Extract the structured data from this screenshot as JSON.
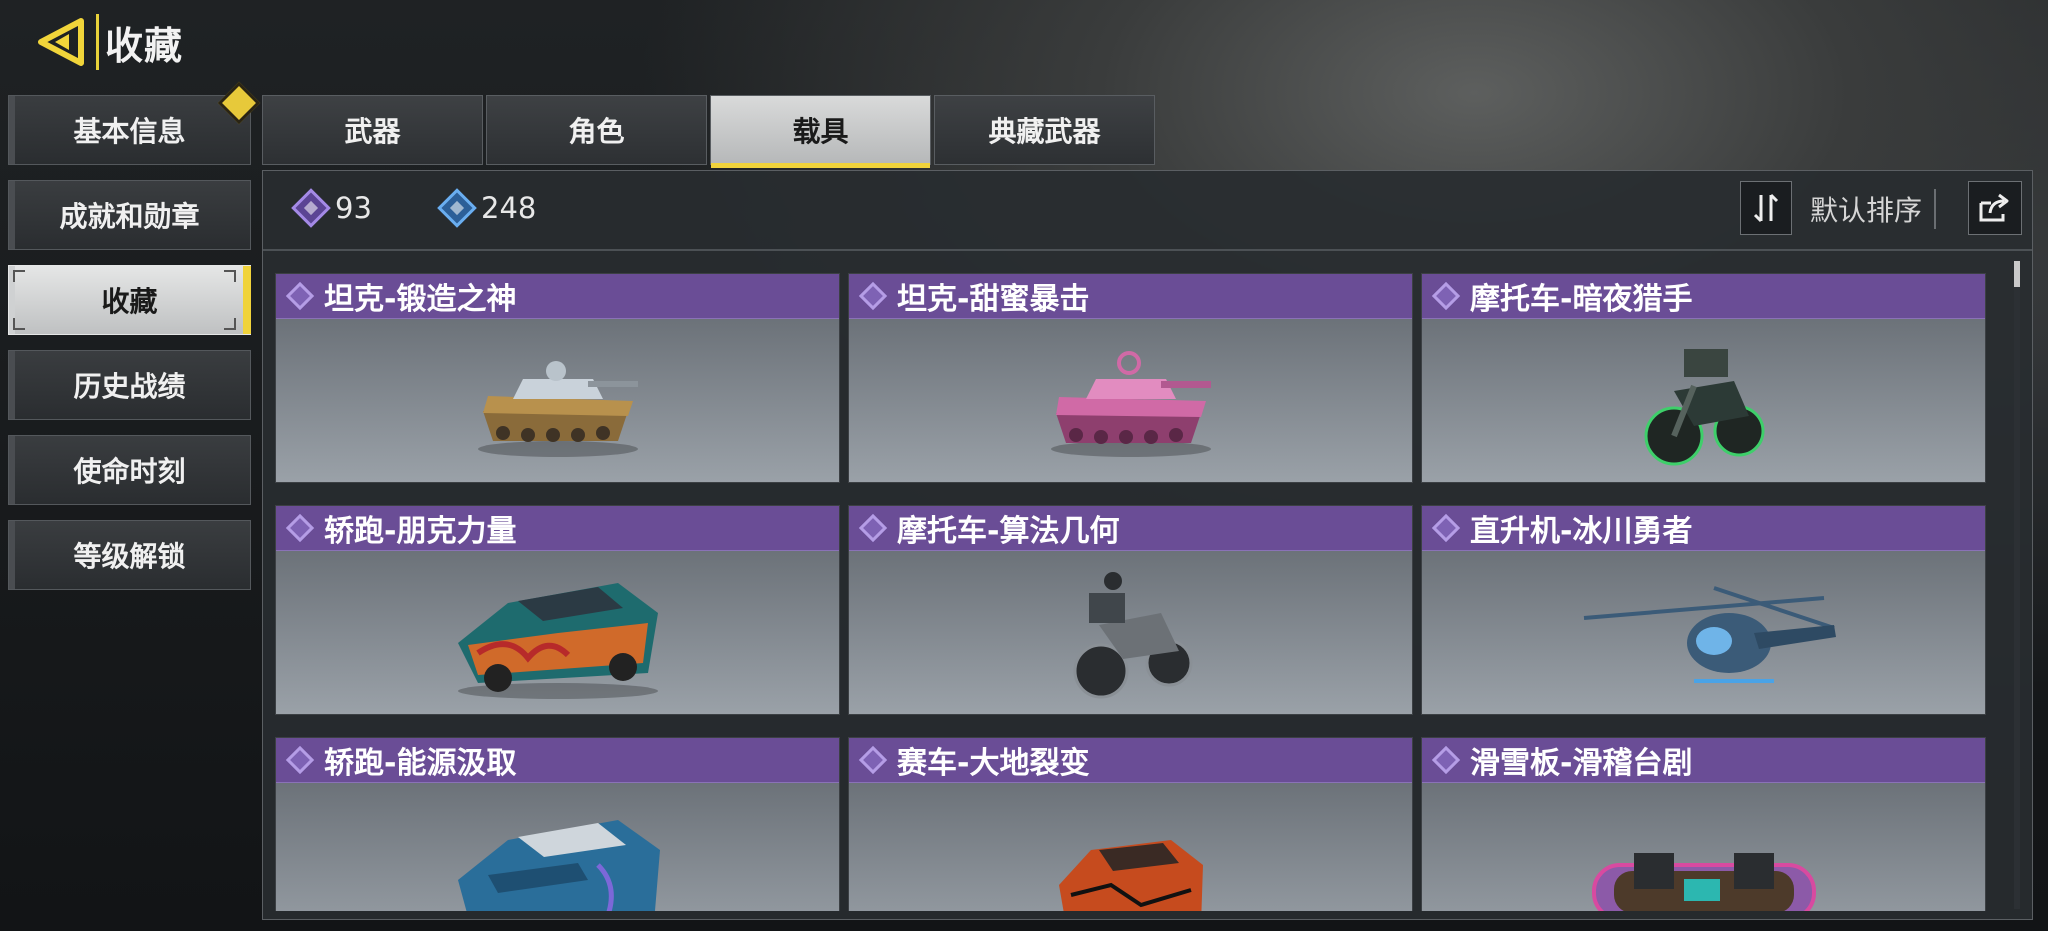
{
  "header": {
    "title": "收藏"
  },
  "sidebar": {
    "items": [
      {
        "label": "基本信息",
        "badge": true
      },
      {
        "label": "成就和勋章"
      },
      {
        "label": "收藏",
        "active": true
      },
      {
        "label": "历史战绩"
      },
      {
        "label": "使命时刻"
      },
      {
        "label": "等级解锁"
      }
    ]
  },
  "tabs": [
    {
      "label": "武器"
    },
    {
      "label": "角色"
    },
    {
      "label": "载具",
      "active": true
    },
    {
      "label": "典藏武器"
    }
  ],
  "toolbar": {
    "currency_purple": "93",
    "currency_blue": "248",
    "sort_label": "默认排序"
  },
  "cards": [
    {
      "name": "坦克-锻造之神",
      "icon": "tank-gold",
      "color": "#b8914d"
    },
    {
      "name": "坦克-甜蜜暴击",
      "icon": "tank-pink",
      "color": "#d06aa6"
    },
    {
      "name": "摩托车-暗夜猎手",
      "icon": "motorcycle-dark",
      "color": "#2c3a36"
    },
    {
      "name": "轿跑-朋克力量",
      "icon": "sportscar-flames",
      "color": "#d06a2a"
    },
    {
      "name": "摩托车-算法几何",
      "icon": "motorcycle-grey",
      "color": "#6c7176"
    },
    {
      "name": "直升机-冰川勇者",
      "icon": "helicopter-ice",
      "color": "#3b5b78"
    },
    {
      "name": "轿跑-能源汲取",
      "icon": "sportscar-blue",
      "color": "#2a6e9a"
    },
    {
      "name": "赛车-大地裂变",
      "icon": "racecar-orange",
      "color": "#c64b1e"
    },
    {
      "name": "滑雪板-滑稽台剧",
      "icon": "snowboard",
      "color": "#8c5aa8"
    }
  ],
  "colors": {
    "accent_yellow": "#f0d33b",
    "card_header_purple": "#6a4d96"
  }
}
